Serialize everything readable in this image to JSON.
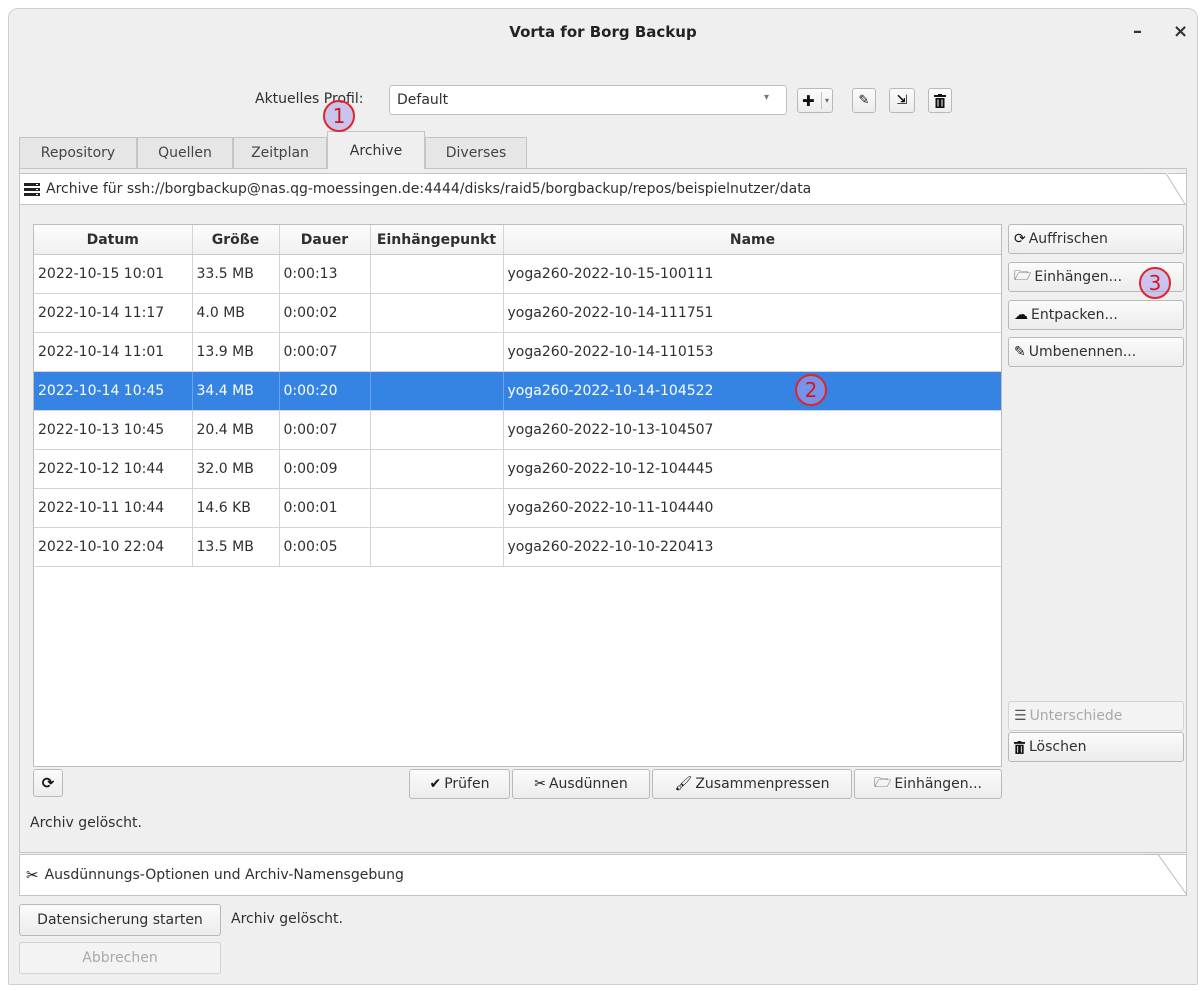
{
  "window": {
    "title": "Vorta for Borg Backup",
    "minimize_label": "–",
    "close_label": "×"
  },
  "profile": {
    "label": "Aktuelles Profil:",
    "value": "Default"
  },
  "profile_tools": [
    {
      "icon": "plus-icon",
      "glyph": "✚"
    },
    {
      "icon": "edit-icon",
      "glyph": "✎"
    },
    {
      "icon": "import-icon",
      "glyph": "⇲"
    },
    {
      "icon": "trash-icon",
      "glyph": "🗑"
    }
  ],
  "tabs": [
    "Repository",
    "Quellen",
    "Zeitplan",
    "Archive",
    "Diverses"
  ],
  "active_tab": "Archive",
  "archive_header": "Archive für ssh://borgbackup@nas.qg-moessingen.de:4444/disks/raid5/borgbackup/repos/beispielnutzer/data",
  "table": {
    "columns": [
      "Datum",
      "Größe",
      "Dauer",
      "Einhängepunkt",
      "Name"
    ],
    "rows": [
      [
        "2022-10-15 10:01",
        "33.5 MB",
        "0:00:13",
        "",
        "yoga260-2022-10-15-100111"
      ],
      [
        "2022-10-14 11:17",
        "4.0 MB",
        "0:00:02",
        "",
        "yoga260-2022-10-14-111751"
      ],
      [
        "2022-10-14 11:01",
        "13.9 MB",
        "0:00:07",
        "",
        "yoga260-2022-10-14-110153"
      ],
      [
        "2022-10-14 10:45",
        "34.4 MB",
        "0:00:20",
        "",
        "yoga260-2022-10-14-104522"
      ],
      [
        "2022-10-13 10:45",
        "20.4 MB",
        "0:00:07",
        "",
        "yoga260-2022-10-13-104507"
      ],
      [
        "2022-10-12 10:44",
        "32.0 MB",
        "0:00:09",
        "",
        "yoga260-2022-10-12-104445"
      ],
      [
        "2022-10-11 10:44",
        "14.6 KB",
        "0:00:01",
        "",
        "yoga260-2022-10-11-104440"
      ],
      [
        "2022-10-10 22:04",
        "13.5 MB",
        "0:00:05",
        "",
        "yoga260-2022-10-10-220413"
      ]
    ],
    "selected_row": 3
  },
  "side_buttons": {
    "refresh": "Auffrischen",
    "mount": "Einhängen...",
    "extract": "Entpacken...",
    "rename": "Umbenennen...",
    "diff": "Unterschiede",
    "delete": "Löschen"
  },
  "bottom_buttons": {
    "check": "Prüfen",
    "prune": "Ausdünnen",
    "compact": "Zusammenpressen",
    "mount": "Einhängen..."
  },
  "status_text": "Archiv gelöscht.",
  "prune_section": "Ausdünnungs-Optionen und Archiv-Namensgebung",
  "footer": {
    "start_backup": "Datensicherung starten",
    "status": "Archiv gelöscht.",
    "cancel": "Abbrechen"
  },
  "annotations": [
    "1",
    "2",
    "3"
  ],
  "colors": {
    "selection": "#3584e4",
    "marker_border": "#e0242a",
    "marker_fill": "#aaa0eb"
  }
}
